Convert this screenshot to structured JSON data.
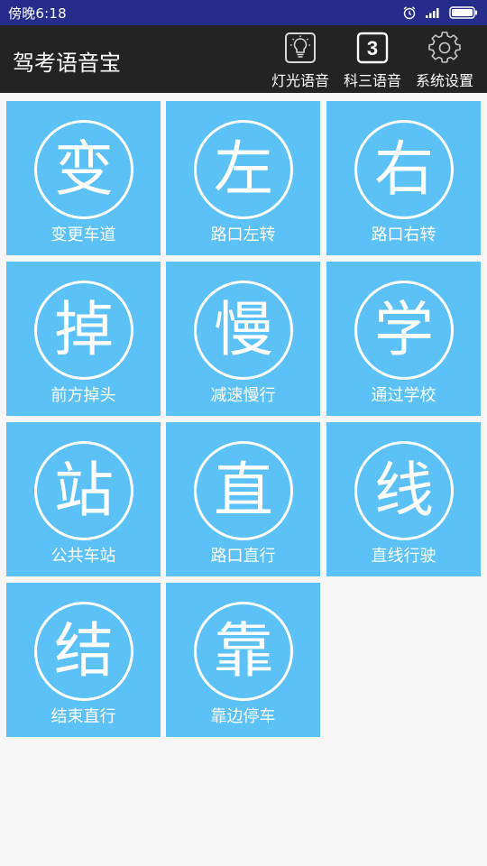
{
  "status_bar": {
    "time": "傍晚6:18",
    "icons": [
      "alarm-icon",
      "signal-icon",
      "battery-icon"
    ]
  },
  "app_bar": {
    "title": "驾考语音宝",
    "actions": [
      {
        "label": "灯光语音",
        "icon": "bulb-icon"
      },
      {
        "label": "科三语音",
        "icon": "course-three-icon",
        "badge": "3"
      },
      {
        "label": "系统设置",
        "icon": "gear-icon"
      }
    ]
  },
  "tiles": [
    {
      "char": "变",
      "label": "变更车道"
    },
    {
      "char": "左",
      "label": "路口左转"
    },
    {
      "char": "右",
      "label": "路口右转"
    },
    {
      "char": "掉",
      "label": "前方掉头"
    },
    {
      "char": "慢",
      "label": "减速慢行"
    },
    {
      "char": "学",
      "label": "通过学校"
    },
    {
      "char": "站",
      "label": "公共车站"
    },
    {
      "char": "直",
      "label": "路口直行"
    },
    {
      "char": "线",
      "label": "直线行驶"
    },
    {
      "char": "结",
      "label": "结束直行"
    },
    {
      "char": "靠",
      "label": "靠边停车"
    }
  ],
  "colors": {
    "status_bar": "#252c8c",
    "app_bar": "#232323",
    "tile": "#5bc1f7",
    "background": "#f7f7f7"
  }
}
